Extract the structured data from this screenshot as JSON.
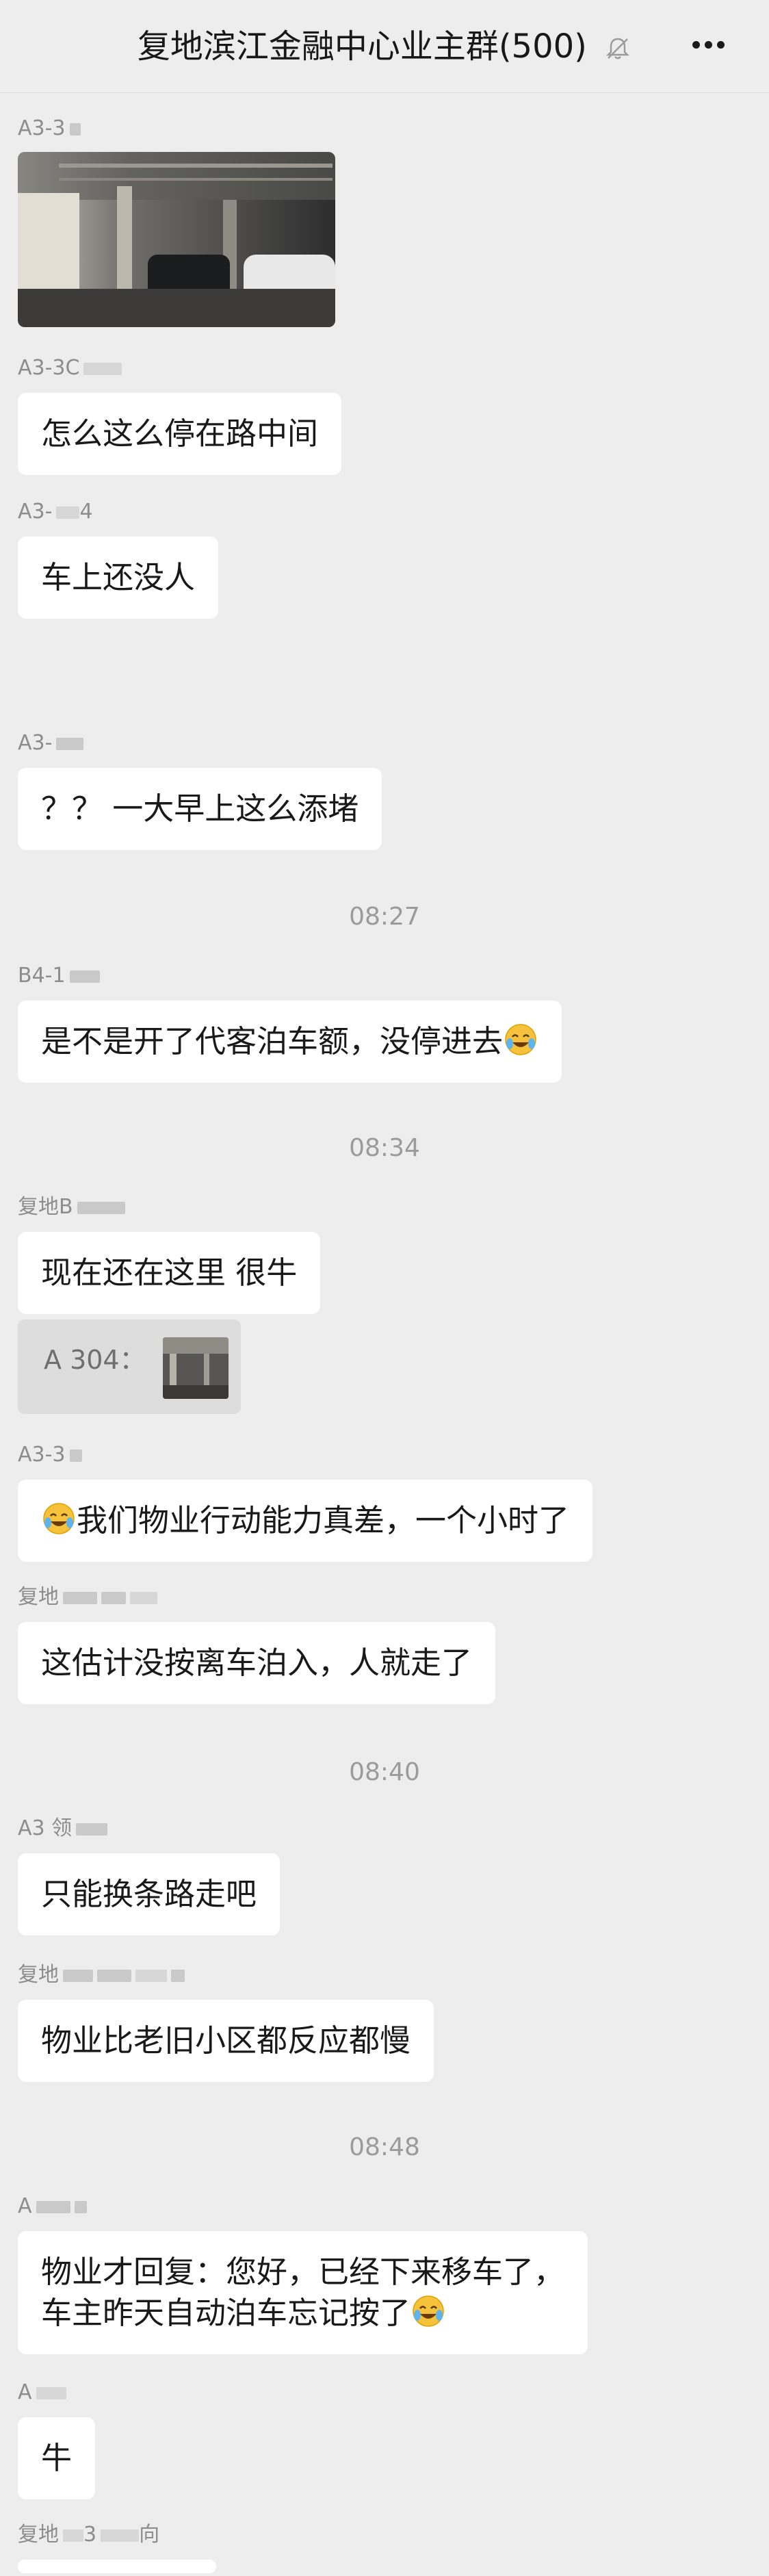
{
  "header": {
    "title": "复地滨江金融中心业主群(500)",
    "mute_icon": "bell-muted-icon",
    "more_icon": "more-dots-icon"
  },
  "messages": [
    {
      "sender": "A3-3",
      "type": "image",
      "image_desc": "parking-garage-photo"
    },
    {
      "sender": "A3-3C",
      "text": "怎么这么停在路中间"
    },
    {
      "sender": "A3-",
      "sender_suffix": "4",
      "text": "车上还没人"
    },
    {
      "sender": "A3-",
      "text": "？？ 一大早上这么添堵"
    },
    {
      "sender": "B4-1",
      "text": "是不是开了代客泊车额，没停进去"
    },
    {
      "sender": "复地B",
      "text": "现在还在这里 很牛",
      "quote": "A   304："
    },
    {
      "sender": "A3-3",
      "text": "我们物业行动能力真差，一个小时了"
    },
    {
      "sender": "复地",
      "text": "这估计没按离车泊入，人就走了"
    },
    {
      "sender": "A3 领",
      "text": "只能换条路走吧"
    },
    {
      "sender": "复地",
      "text": "物业比老旧小区都反应都慢"
    },
    {
      "sender": "A",
      "text_line1": "物业才回复：您好，已经下来移车了，",
      "text_line2": "车主昨天自动泊车忘记按了"
    },
    {
      "sender": "A",
      "text": "牛"
    },
    {
      "sender": "复地",
      "sender_suffix": "3",
      "sender_tail": "向"
    }
  ],
  "times": [
    "08:27",
    "08:34",
    "08:40",
    "08:48"
  ],
  "emoji_name": "crying-laughing-emoji",
  "colors": {
    "background": "#ededed",
    "bubble": "#ffffff",
    "sender": "#8d8d8d",
    "time": "#9b9b9b"
  }
}
